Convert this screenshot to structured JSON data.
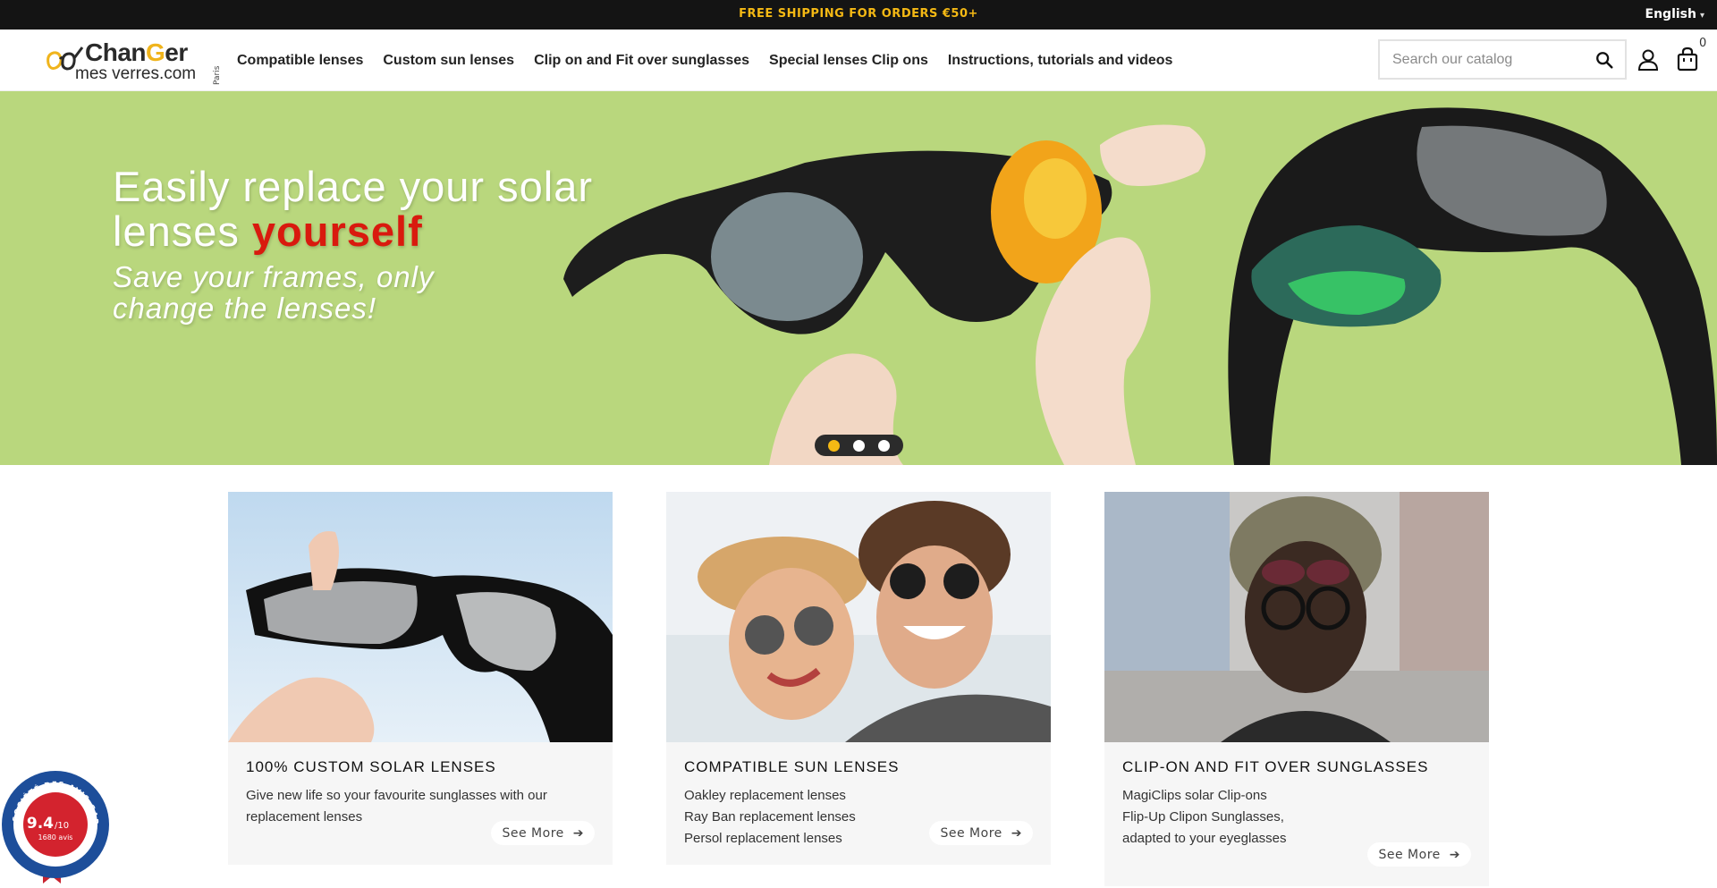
{
  "topbar": {
    "promo": "FREE SHIPPING FOR ORDERS €50+",
    "language": "English",
    "promo_color": "#f5b914"
  },
  "header": {
    "logo": {
      "brand_top_pre": "Chan",
      "brand_top_g": "G",
      "brand_top_post": "er",
      "brand_bottom": "mes verres.com",
      "city": "Paris"
    },
    "nav": [
      "Compatible lenses",
      "Custom sun lenses",
      "Clip on and Fit over sunglasses",
      "Special lenses Clip ons",
      "Instructions, tutorials and videos"
    ],
    "search_placeholder": "Search our catalog",
    "cart_count": "0",
    "icons": [
      "search-icon",
      "user-icon",
      "cart-icon"
    ]
  },
  "hero": {
    "title_white": "Easily replace your solar lenses ",
    "title_red": "yourself",
    "subtitle": "Save your frames, only change the lenses!",
    "background": "#b9d77d",
    "accent_red": "#d91a0e",
    "slides": 3,
    "active_slide": 1
  },
  "cards": [
    {
      "title": "100% CUSTOM SOLAR LENSES",
      "lines": [
        "Give new life so your favourite sunglasses with our",
        "replacement lenses"
      ],
      "cta": "See More"
    },
    {
      "title": "COMPATIBLE SUN LENSES",
      "lines": [
        "Oakley replacement lenses",
        "Ray Ban replacement lenses",
        "Persol replacement lenses"
      ],
      "cta": "See More"
    },
    {
      "title": "CLIP-ON AND FIT OVER SUNGLASSES",
      "lines": [
        "MagiClips solar Clip-ons",
        "Flip-Up Clipon Sunglasses,",
        "adapted to your eyeglasses"
      ],
      "cta": "See More"
    }
  ],
  "badge": {
    "score": "9.4",
    "scale": "/10",
    "reviews": "1680 avis",
    "ring_text": "SOCIÉTÉ DES AVIS GARANTIS"
  }
}
